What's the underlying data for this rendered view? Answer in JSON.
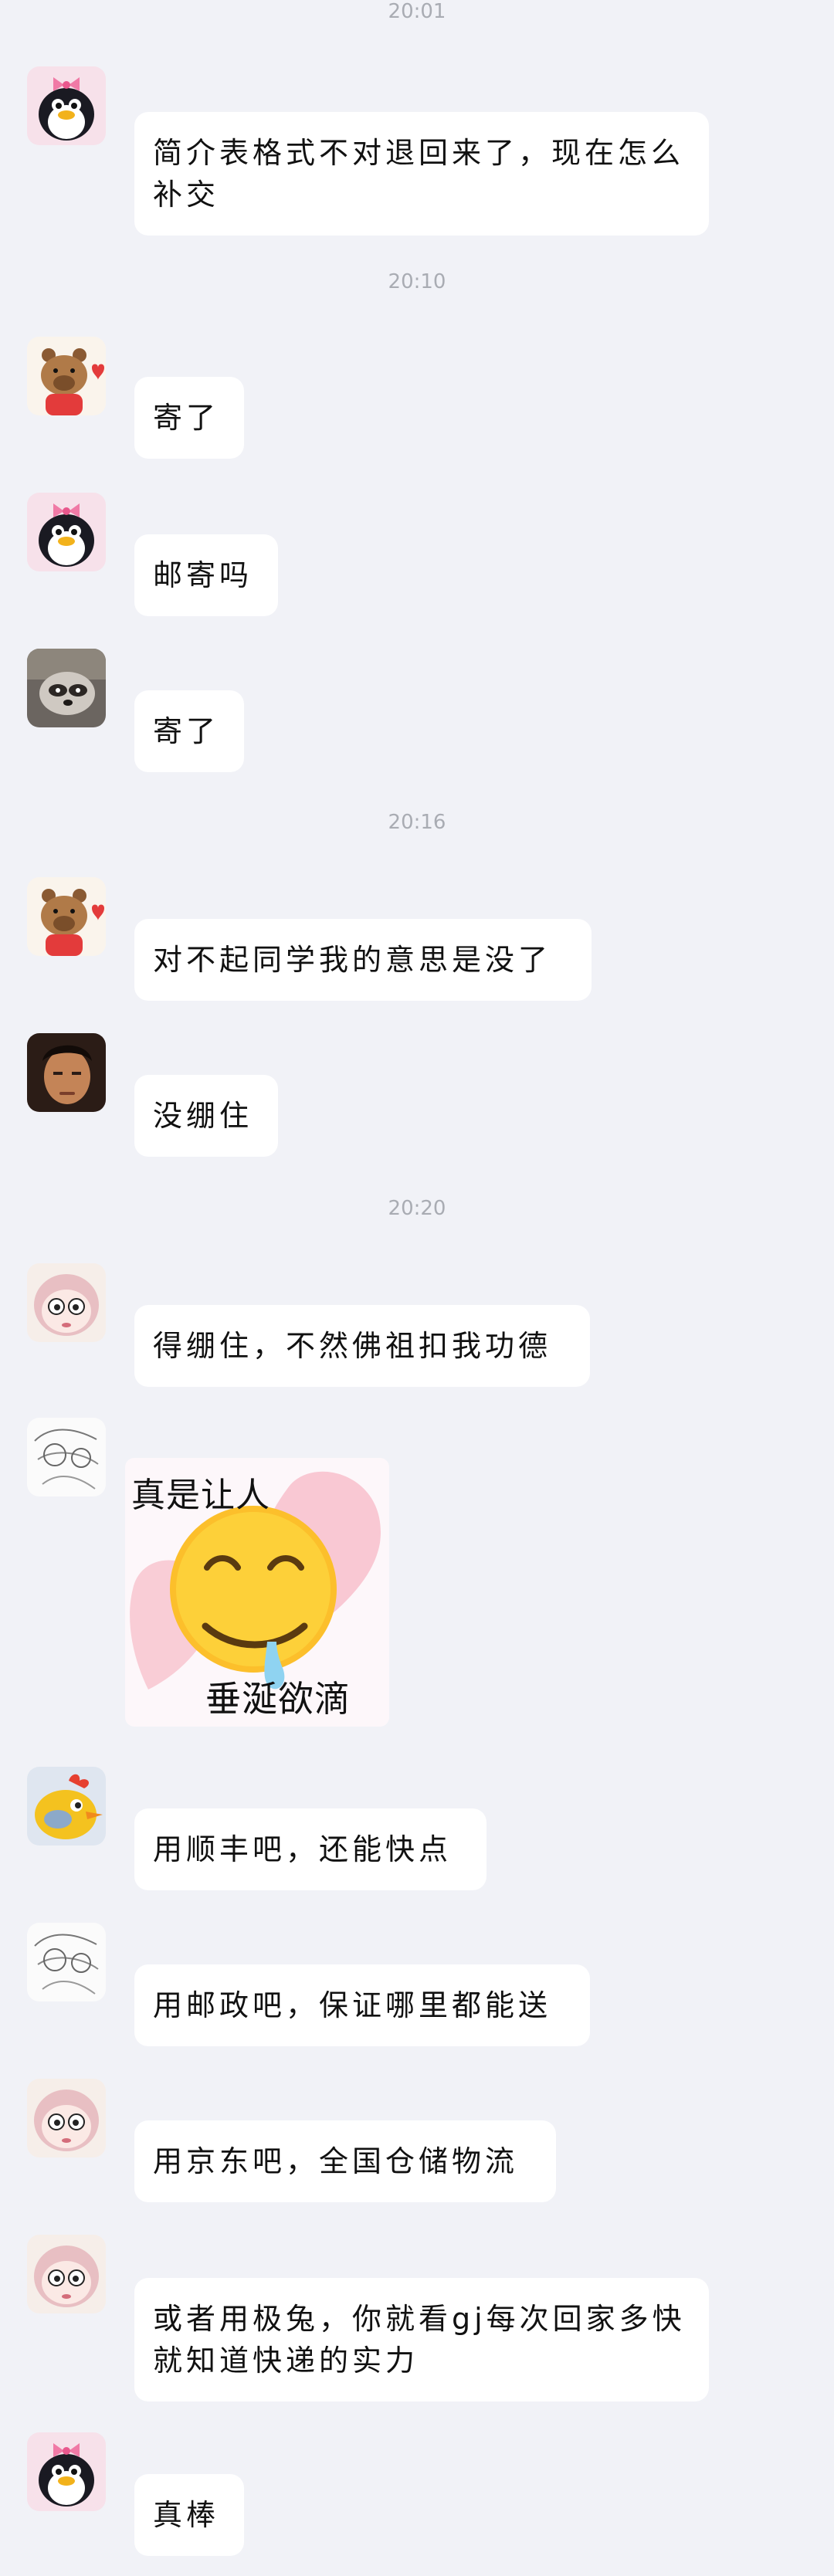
{
  "timestamps": [
    "20:01",
    "20:10",
    "20:16",
    "20:20"
  ],
  "messages": [
    {
      "sender": "penguin",
      "text": "简介表格式不对退回来了，现在怎么补交"
    },
    {
      "sender": "capybara",
      "text": "寄了"
    },
    {
      "sender": "penguin",
      "text": "邮寄吗"
    },
    {
      "sender": "raccoon",
      "text": "寄了"
    },
    {
      "sender": "capybara",
      "text": "对不起同学我的意思是没了"
    },
    {
      "sender": "person",
      "text": "没绷住"
    },
    {
      "sender": "blush-face",
      "text": "得绷住，不然佛祖扣我功德"
    },
    {
      "sender": "sketch",
      "sticker": {
        "top_text": "真是让人",
        "bottom_text": "垂涎欲滴",
        "emoji": "drooling-face"
      }
    },
    {
      "sender": "yellow-bird",
      "text": "用顺丰吧，还能快点"
    },
    {
      "sender": "sketch",
      "text": "用邮政吧，保证哪里都能送"
    },
    {
      "sender": "blush-face",
      "text": "用京东吧，全国仓储物流"
    },
    {
      "sender": "blush-face",
      "text": "或者用极兔，你就看gj每次回家多快就知道快递的实力"
    },
    {
      "sender": "penguin",
      "text": "真棒"
    }
  ]
}
